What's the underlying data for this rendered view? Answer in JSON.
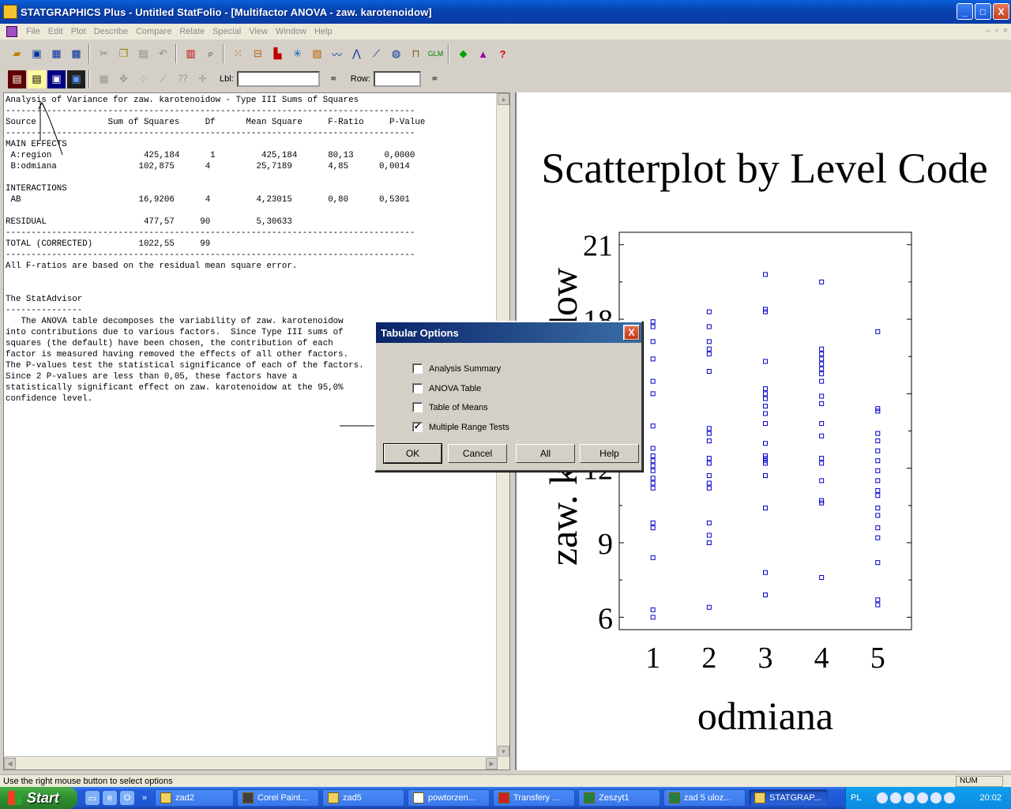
{
  "window": {
    "title": "STATGRAPHICS Plus - Untitled StatFolio - [Multifactor ANOVA - zaw. karotenoidow]",
    "controls": {
      "minimize": "_",
      "maximize": "□",
      "close": "X"
    }
  },
  "menu": [
    "File",
    "Edit",
    "Plot",
    "Describe",
    "Compare",
    "Relate",
    "Special",
    "View",
    "Window",
    "Help"
  ],
  "toolbar2": {
    "lbl_label": "Lbl:",
    "row_label": "Row:"
  },
  "text_pane": {
    "lines": [
      "Analysis of Variance for zaw. karotenoidow - Type III Sums of Squares",
      "--------------------------------------------------------------------------------",
      "Source              Sum of Squares     Df      Mean Square     F-Ratio     P-Value",
      "--------------------------------------------------------------------------------",
      "MAIN EFFECTS",
      " A:region                  425,184      1         425,184      80,13      0,0000",
      " B:odmiana                102,875      4         25,7189       4,85      0,0014",
      "",
      "INTERACTIONS",
      " AB                       16,9206      4         4,23015       0,80      0,5301",
      "",
      "RESIDUAL                   477,57     90         5,30633",
      "--------------------------------------------------------------------------------",
      "TOTAL (CORRECTED)         1022,55     99",
      "--------------------------------------------------------------------------------",
      "All F-ratios are based on the residual mean square error.",
      "",
      "",
      "The StatAdvisor",
      "---------------",
      "   The ANOVA table decomposes the variability of zaw. karotenoidow",
      "into contributions due to various factors.  Since Type III sums of",
      "squares (the default) have been chosen, the contribution of each",
      "factor is measured having removed the effects of all other factors.",
      "The P-values test the statistical significance of each of the factors.",
      "Since 2 P-values are less than 0,05, these factors have a",
      "statistically significant effect on zaw. karotenoidow at the 95,0%",
      "confidence level."
    ]
  },
  "chart_data": {
    "type": "scatter",
    "title": "Scatterplot by Level Code",
    "xlabel": "odmiana",
    "ylabel": "zaw. karotenoidow",
    "x_ticks": [
      "1",
      "2",
      "3",
      "4",
      "5"
    ],
    "y_ticks": [
      "6",
      "9",
      "12",
      "15",
      "18",
      "21"
    ],
    "xlim": [
      0.4,
      5.6
    ],
    "ylim": [
      5.5,
      21.5
    ],
    "grid": false,
    "marker": "hollow-square",
    "color": "#0000cc",
    "series": [
      {
        "x": 1,
        "values": [
          17.9,
          17.7,
          17.1,
          16.4,
          15.5,
          15.0,
          13.7,
          12.8,
          12.5,
          12.3,
          12.1,
          11.9,
          11.6,
          11.4,
          11.2,
          9.8,
          9.6,
          8.4,
          6.3,
          6.0
        ]
      },
      {
        "x": 2,
        "values": [
          18.3,
          17.7,
          17.1,
          16.8,
          16.6,
          15.9,
          13.6,
          13.4,
          13.1,
          12.4,
          12.2,
          11.7,
          11.4,
          11.2,
          9.8,
          9.3,
          9.0,
          6.4
        ]
      },
      {
        "x": 3,
        "values": [
          19.8,
          18.4,
          18.3,
          16.3,
          15.2,
          15.0,
          14.8,
          14.5,
          14.2,
          13.8,
          13.0,
          12.5,
          12.4,
          12.3,
          12.2,
          11.7,
          10.4,
          7.8,
          6.9
        ]
      },
      {
        "x": 4,
        "values": [
          19.5,
          16.8,
          16.6,
          16.4,
          16.2,
          16.0,
          15.8,
          15.5,
          14.9,
          14.6,
          13.8,
          13.3,
          12.4,
          12.2,
          11.5,
          10.7,
          10.6,
          7.6
        ]
      },
      {
        "x": 5,
        "values": [
          17.5,
          14.4,
          14.3,
          13.4,
          13.1,
          12.7,
          12.3,
          11.9,
          11.5,
          11.1,
          10.9,
          10.4,
          10.1,
          9.6,
          9.2,
          8.2,
          6.7,
          6.5
        ]
      }
    ]
  },
  "dialog": {
    "title": "Tabular Options",
    "close_label": "X",
    "options": [
      {
        "label": "Analysis Summary",
        "checked": false
      },
      {
        "label": "ANOVA Table",
        "checked": false
      },
      {
        "label": "Table of Means",
        "checked": false
      },
      {
        "label": "Multiple Range Tests",
        "checked": true
      }
    ],
    "buttons": {
      "ok": "OK",
      "cancel": "Cancel",
      "all": "All",
      "help": "Help"
    }
  },
  "status": {
    "message": "Use the right mouse button to select options",
    "num": "NUM"
  },
  "taskbar": {
    "start": "Start",
    "tasks": [
      "zad2",
      "Corel Paint...",
      "zad5",
      "powtorzen...",
      "Transfery ...",
      "Zeszyt1",
      "zad 5 uloz...",
      "STATGRAP..."
    ],
    "lang": "PL",
    "clock": "20:02"
  }
}
